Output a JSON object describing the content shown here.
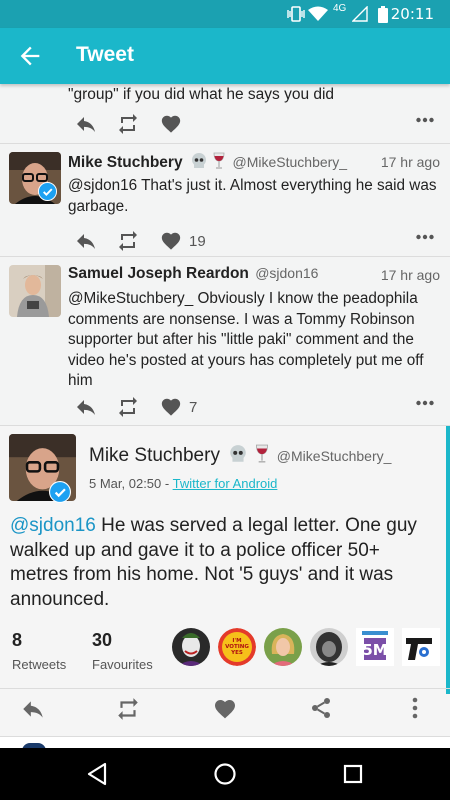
{
  "status_bar": {
    "time": "20:11",
    "network": "4G"
  },
  "toolbar": {
    "title": "Tweet"
  },
  "partial_tweet": {
    "text": "\"group\" if you did what he says you did"
  },
  "tweets": [
    {
      "name": "Mike Stuchbery",
      "handle": "@MikeStuchbery_",
      "time": "17 hr ago",
      "text": "@sjdon16 That's just it. Almost everything he said was garbage.",
      "likes": "19"
    },
    {
      "name": "Samuel Joseph Reardon",
      "handle": "@sjdon16",
      "time": "17 hr ago",
      "text": "@MikeStuchbery_ Obviously I know the peadophila comments are nonsense. I was a Tommy Robinson supporter but after his \"little paki\" comment and the video he's posted at yours has completely put me off him",
      "likes": "7"
    }
  ],
  "focused_tweet": {
    "name": "Mike Stuchbery",
    "handle": "@MikeStuchbery_",
    "date": "5 Mar, 02:50",
    "separator": " - ",
    "via": "Twitter for Android",
    "mention": "@sjdon16",
    "text": " He was served a legal letter. One guy walked up and gave it to a police officer 50+ metres from his home. Not '5 guys' and it was announced.",
    "retweets": "8",
    "retweets_label": "Retweets",
    "favourites": "30",
    "favourites_label": "Favourites",
    "likers": [
      "Joker avatar",
      "I'm voting yes in the ballot badge",
      "Woman avatar",
      "Dark avatar",
      "5M badge",
      "Revolver logo"
    ]
  },
  "colors": {
    "accent": "#1bb7ca",
    "status_bar": "#1ba1b1",
    "mention": "#1b95c6"
  }
}
